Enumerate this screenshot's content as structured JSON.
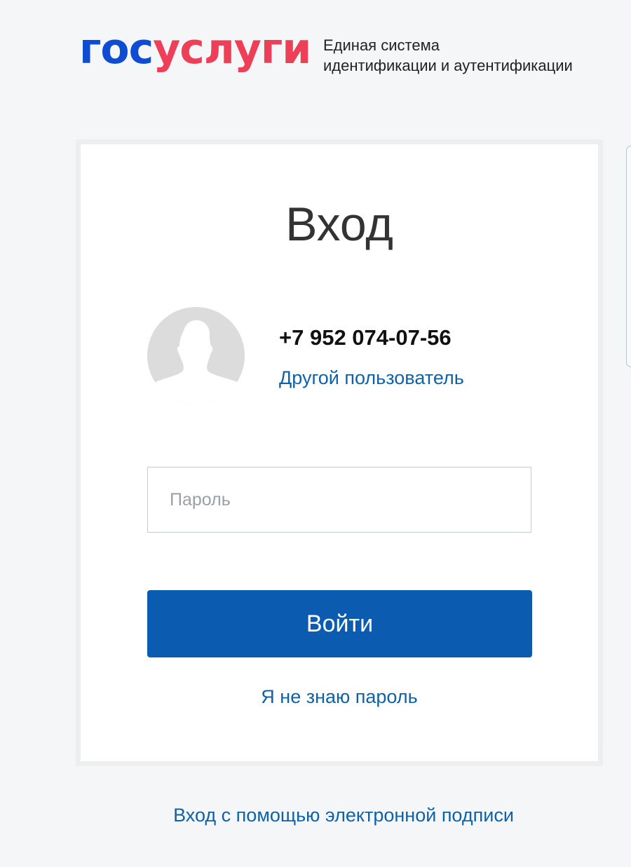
{
  "header": {
    "logo": {
      "part1": "гос",
      "part2": "услуги"
    },
    "subtitle": {
      "line1": "Единая система",
      "line2": "идентификации и аутентификации"
    }
  },
  "login": {
    "title": "Вход",
    "user": {
      "phone": "+7 952 074-07-56",
      "other_user_link": "Другой пользователь",
      "avatar_icon": "user-silhouette-icon"
    },
    "password": {
      "placeholder": "Пароль",
      "value": ""
    },
    "submit_label": "Войти",
    "forgot_password_link": "Я не знаю пароль"
  },
  "footer": {
    "esign_link": "Вход с помощью электронной подписи"
  },
  "colors": {
    "background": "#f5f6f7",
    "logo_blue": "#0d4cd3",
    "logo_red": "#ee3f58",
    "primary_button": "#0b5cb0",
    "link": "#0f62a8",
    "avatar_bg": "#dcdcdc"
  }
}
